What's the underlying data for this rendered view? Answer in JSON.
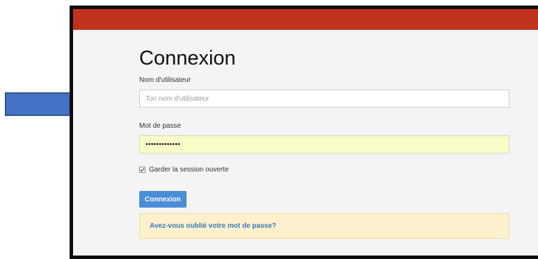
{
  "colors": {
    "header_bar": "#c0311e",
    "arrow_fill": "#4472c4",
    "arrow_stroke": "#2f528f",
    "button": "#4a8ed8",
    "password_field_bg": "#fafcc8",
    "forgot_box_bg": "#fcf1cc"
  },
  "arrow": {
    "icon": "right-arrow-icon"
  },
  "login": {
    "title": "Connexion",
    "username": {
      "label": "Nom d'utilisateur",
      "placeholder": "Ton nom d'utilisateur",
      "value": ""
    },
    "password": {
      "label": "Mot de passe",
      "value": "•••••••••••••"
    },
    "remember": {
      "label": "Garder la session ouverte",
      "checked": true
    },
    "submit_label": "Connexion",
    "forgot_label": "Avez-vous oublié votre mot de passe?"
  }
}
